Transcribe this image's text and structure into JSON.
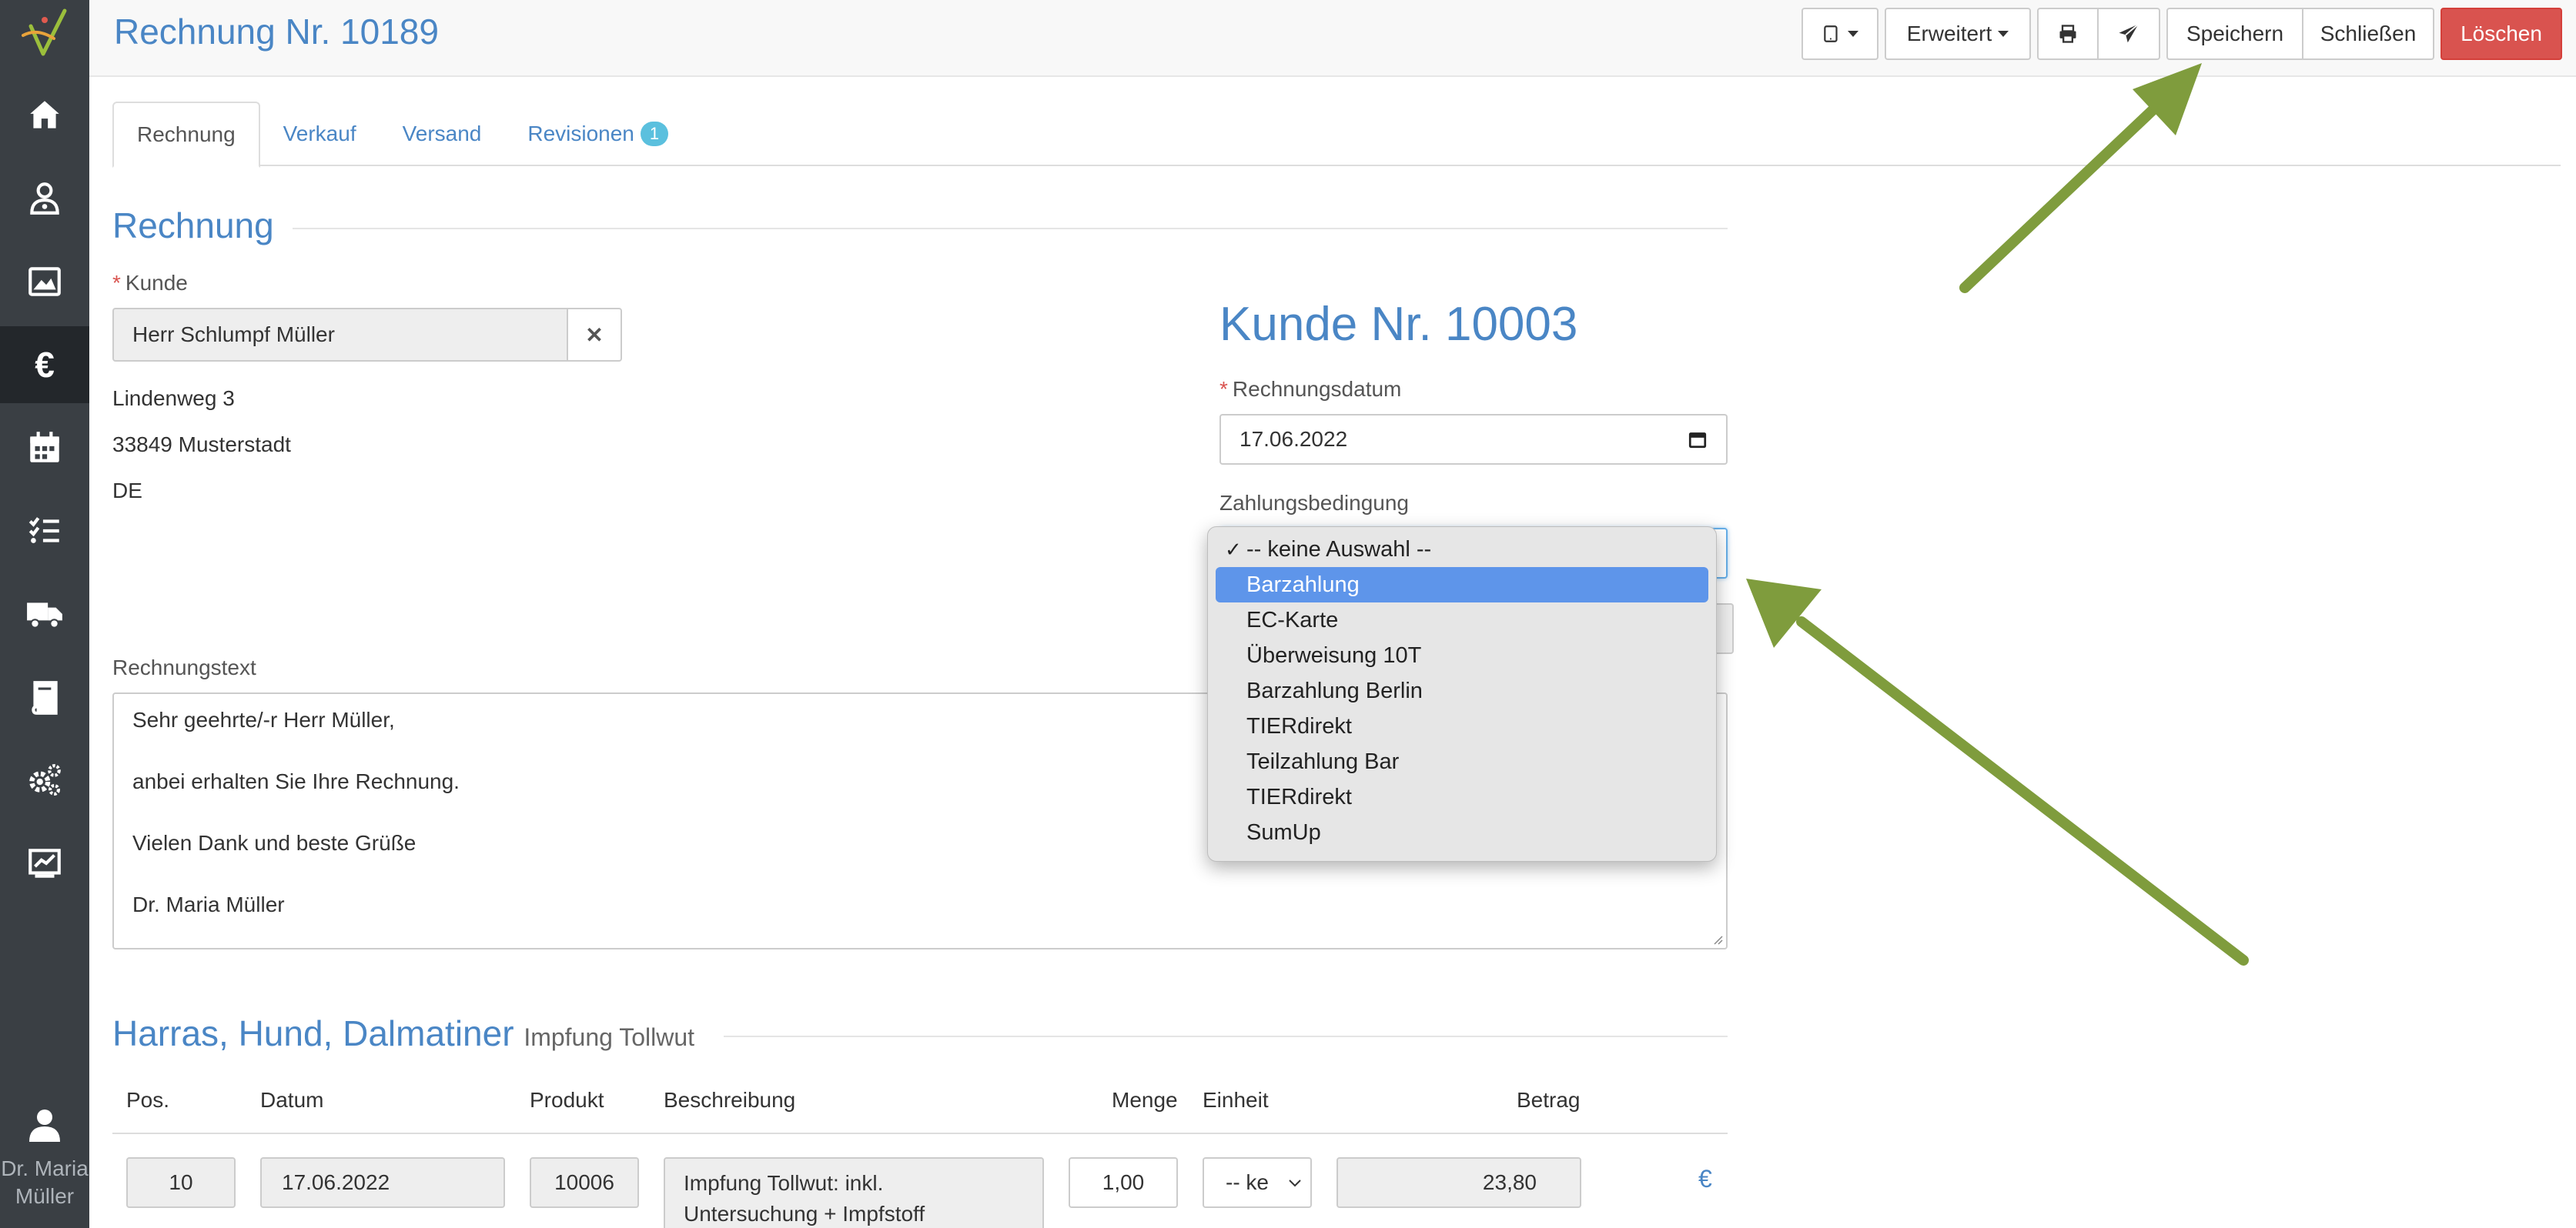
{
  "app": {
    "title": "Rechnung Nr. 10189",
    "user_name": "Dr. Maria\nMüller"
  },
  "sidebar": {
    "items": [
      {
        "icon": "home-icon"
      },
      {
        "icon": "patients-icon"
      },
      {
        "icon": "image-icon"
      },
      {
        "icon": "euro-icon",
        "glyph": "€"
      },
      {
        "icon": "calendar-icon"
      },
      {
        "icon": "tasks-icon"
      },
      {
        "icon": "truck-icon"
      },
      {
        "icon": "book-icon"
      },
      {
        "icon": "settings-icon"
      },
      {
        "icon": "statistics-icon"
      }
    ]
  },
  "toolbar": {
    "advanced_label": "Erweitert",
    "save_label": "Speichern",
    "close_label": "Schließen",
    "delete_label": "Löschen"
  },
  "tabs": [
    {
      "label": "Rechnung"
    },
    {
      "label": "Verkauf"
    },
    {
      "label": "Versand"
    },
    {
      "label": "Revisionen",
      "badge": "1"
    }
  ],
  "invoice": {
    "section_title": "Rechnung",
    "customer_label": "Kunde",
    "customer_value": "Herr Schlumpf Müller",
    "clear_symbol": "✕",
    "address": {
      "street": "Lindenweg 3",
      "city": "33849 Musterstadt",
      "country": "DE"
    },
    "customer_number_title": "Kunde Nr. 10003",
    "date_label": "Rechnungsdatum",
    "date_value": "17.06.2022",
    "payment_label": "Zahlungsbedingung",
    "text_label": "Rechnungstext",
    "text_lines": [
      "Sehr geehrte/-r Herr Müller,",
      "anbei erhalten Sie Ihre Rechnung.",
      "Vielen Dank und beste Grüße",
      "Dr. Maria Müller"
    ]
  },
  "payment_dropdown": {
    "options": [
      {
        "label": "-- keine Auswahl --",
        "checked": true
      },
      {
        "label": "Barzahlung",
        "highlighted": true
      },
      {
        "label": "EC-Karte"
      },
      {
        "label": "Überweisung 10T"
      },
      {
        "label": "Barzahlung Berlin"
      },
      {
        "label": "TIERdirekt"
      },
      {
        "label": "Teilzahlung Bar"
      },
      {
        "label": "TIERdirekt"
      },
      {
        "label": "SumUp"
      }
    ]
  },
  "animal": {
    "title": "Harras, Hund, Dalmatiner",
    "subtitle": "Impfung Tollwut"
  },
  "table": {
    "headers": {
      "pos": "Pos.",
      "datum": "Datum",
      "produkt": "Produkt",
      "beschreibung": "Beschreibung",
      "menge": "Menge",
      "einheit": "Einheit",
      "betrag": "Betrag"
    },
    "rows": [
      {
        "pos": "10",
        "datum": "17.06.2022",
        "produkt": "10006",
        "beschreibung_line1": "Impfung Tollwut: inkl.",
        "beschreibung_line2": "Untersuchung + Impfstoff",
        "menge": "1,00",
        "einheit": "-- ke",
        "betrag": "23,80",
        "currency": "€"
      }
    ]
  },
  "colors": {
    "brand_blue": "#4a86c5",
    "sidebar_bg": "#3a3f44",
    "danger": "#d9534f",
    "arrow_green": "#7f9c3d",
    "dropdown_highlight": "#5e95ea"
  }
}
